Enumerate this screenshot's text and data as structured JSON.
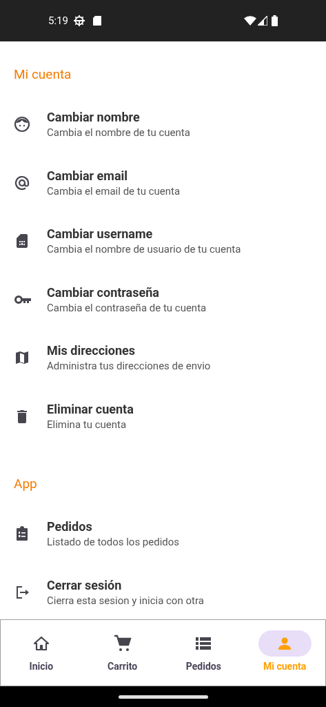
{
  "status_bar": {
    "time": "5:19"
  },
  "sections": [
    {
      "title": "Mi cuenta",
      "items": [
        {
          "title": "Cambiar nombre",
          "subtitle": "Cambia el nombre de tu cuenta"
        },
        {
          "title": "Cambiar email",
          "subtitle": "Cambia el email de tu cuenta"
        },
        {
          "title": "Cambiar username",
          "subtitle": "Cambia el nombre de usuario de tu cuenta"
        },
        {
          "title": "Cambiar contraseña",
          "subtitle": "Cambia el contraseña de tu cuenta"
        },
        {
          "title": "Mis direcciones",
          "subtitle": "Administra tus direcciones de envio"
        },
        {
          "title": "Eliminar cuenta",
          "subtitle": "Elimina tu cuenta"
        }
      ]
    },
    {
      "title": "App",
      "items": [
        {
          "title": "Pedidos",
          "subtitle": "Listado de todos los pedidos"
        },
        {
          "title": "Cerrar sesión",
          "subtitle": "Cierra esta sesion y inicia con otra"
        }
      ]
    }
  ],
  "nav": [
    {
      "label": "Inicio",
      "selected": false
    },
    {
      "label": "Carrito",
      "selected": false
    },
    {
      "label": "Pedidos",
      "selected": false
    },
    {
      "label": "Mi cuenta",
      "selected": true
    }
  ]
}
